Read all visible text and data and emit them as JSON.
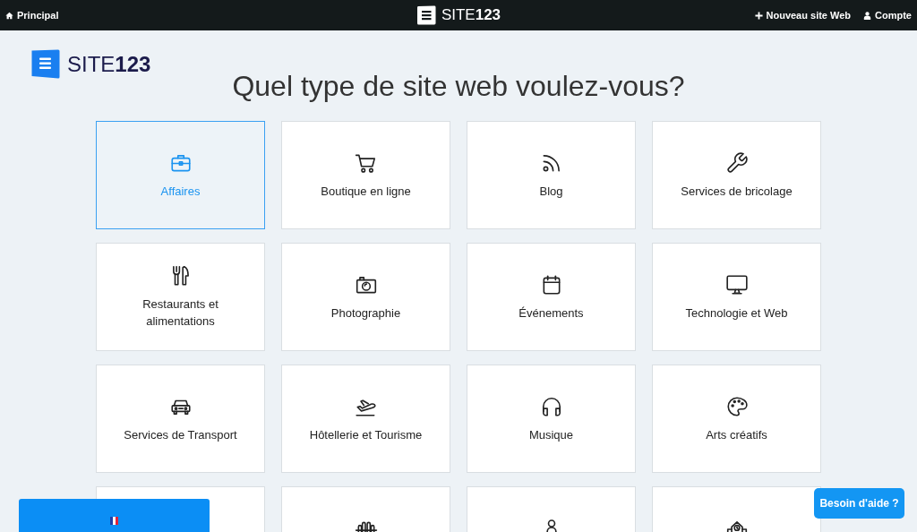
{
  "top_bar": {
    "home_link": "Principal",
    "logo": "SITE**123**",
    "new_site_link": "Nouveau site Web",
    "account_link": "Compte"
  },
  "logo": "SITE**123**",
  "heading": "Quel type de site web voulez-vous?",
  "site_types": [
    {
      "label": "Affaires",
      "kind": "briefcase",
      "selected": true
    },
    {
      "label": "Boutique en ligne",
      "kind": "cart",
      "selected": false
    },
    {
      "label": "Blog",
      "kind": "feed",
      "selected": false
    },
    {
      "label": "Services de bricolage",
      "kind": "wrench",
      "selected": false
    },
    {
      "label": "Restaurants et alimentations",
      "kind": "cutlery",
      "selected": false
    },
    {
      "label": "Photographie",
      "kind": "camera",
      "selected": false
    },
    {
      "label": "Événements",
      "kind": "calendar",
      "selected": false
    },
    {
      "label": "Technologie et Web",
      "kind": "monitor",
      "selected": false
    },
    {
      "label": "Services de Transport",
      "kind": "car",
      "selected": false
    },
    {
      "label": "Hôtellerie et Tourisme",
      "kind": "plane",
      "selected": false
    },
    {
      "label": "Musique",
      "kind": "headphones",
      "selected": false
    },
    {
      "label": "Arts créatifs",
      "kind": "palette",
      "selected": false
    },
    {
      "selected": false
    },
    {
      "kind": "barbell",
      "selected": false
    },
    {
      "kind": "person",
      "selected": false
    },
    {
      "kind": "building",
      "selected": false
    }
  ],
  "help_button": "Besoin d'aide ?"
}
